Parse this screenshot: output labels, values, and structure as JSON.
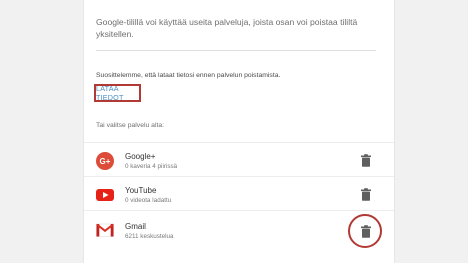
{
  "intro_text": "Google-tilillä voi käyttää useita palveluja, joista osan voi poistaa tililtä yksitellen.",
  "recommend_text": "Suosittelemme, että lataat tietosi ennen palvelun poistamista.",
  "download_label": "LATAA TIEDOT",
  "choose_text": "Tai valitse palvelu alta:",
  "services": [
    {
      "name": "Google+",
      "meta": "0 kaveria 4 piirissä",
      "icon": "google-plus-icon"
    },
    {
      "name": "YouTube",
      "meta": "0 videota ladattu",
      "icon": "youtube-icon"
    },
    {
      "name": "Gmail",
      "meta": "6211 keskustelua",
      "icon": "gmail-icon"
    }
  ],
  "colors": {
    "background": "#f1f1f1",
    "card": "#ffffff",
    "highlight": "#b23a35",
    "link": "#4a90c8",
    "google_plus": "#dd4b39",
    "youtube": "#e62117",
    "trash": "#5f5f5f"
  }
}
